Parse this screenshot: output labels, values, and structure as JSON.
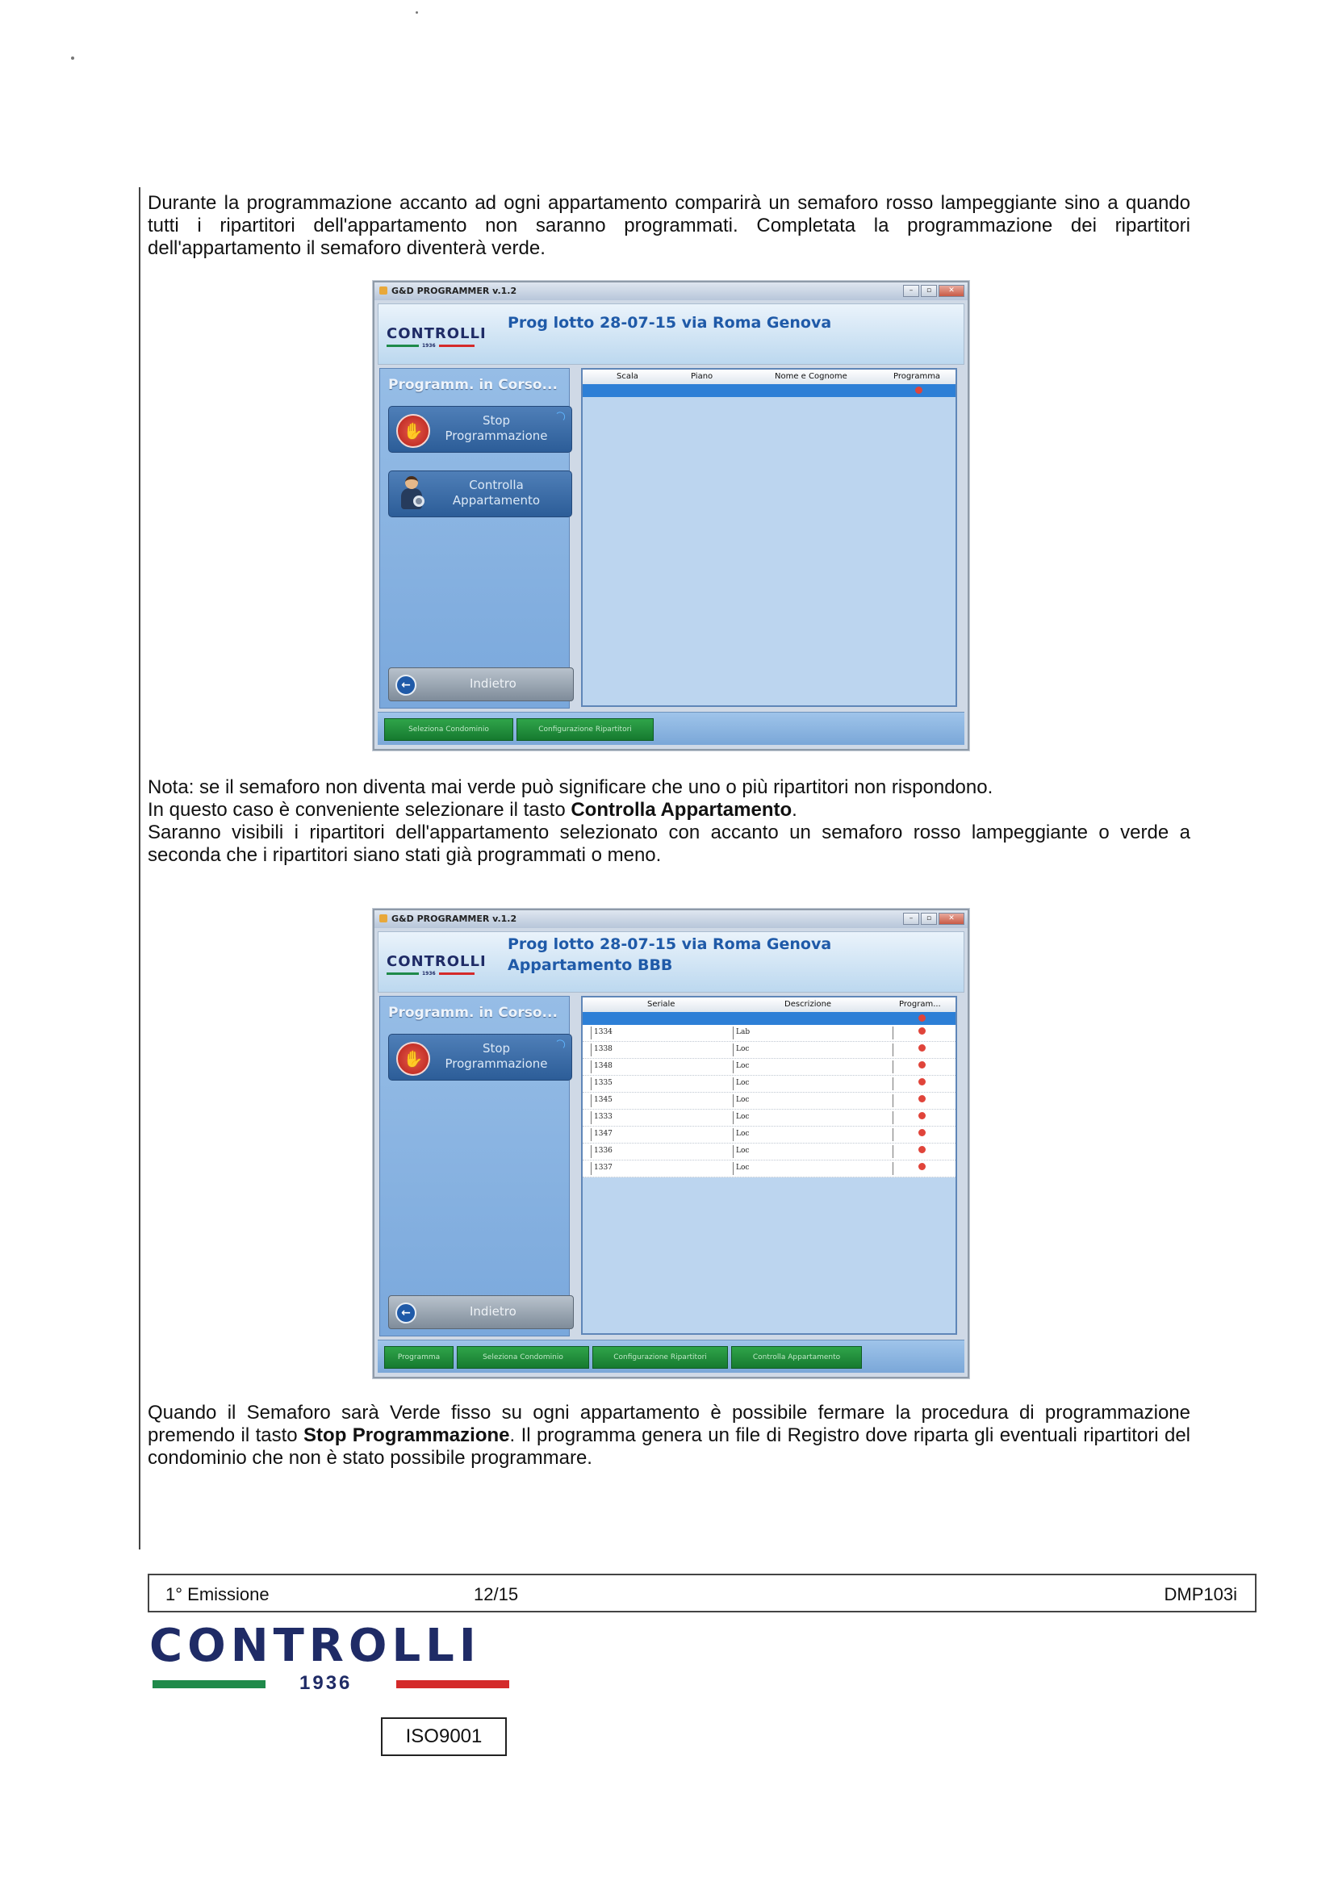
{
  "intro": {
    "text": "Durante la programmazione accanto ad ogni appartamento comparirà un semaforo rosso lampeggiante sino a quando tutti i ripartitori dell'appartamento non saranno programmati. Completata la programmazione dei ripartitori dell'appartamento il semaforo diventerà verde."
  },
  "screenshot1": {
    "window_title": "G&D PROGRAMMER v.1.2",
    "logo_word": "CONTROLLI",
    "logo_year": "1936",
    "header_title": "Prog lotto 28-07-15 via Roma Genova",
    "status": "Programm. in Corso...",
    "stop_button": {
      "line1": "Stop",
      "line2": "Programmazione"
    },
    "check_button": {
      "line1": "Controlla",
      "line2": "Appartamento"
    },
    "back_button": "Indietro",
    "columns": [
      "Scala",
      "Piano",
      "Nome e Cognome",
      "Programma"
    ],
    "tabs": [
      "Seleziona Condominio",
      "Configurazione Ripartitori"
    ],
    "colors": {
      "accent": "#1f5aa8",
      "panel": "#7aa8dc",
      "selection": "#2d7fd6",
      "tab": "#167a2f",
      "semaforo": "#e0443a"
    }
  },
  "notes": {
    "line1": "Nota: se il semaforo non diventa mai verde può significare che uno o più ripartitori non rispondono.",
    "line2_prefix": "In questo caso è conveniente selezionare il tasto ",
    "line2_bold": "Controlla Appartamento",
    "line2_suffix": ".",
    "line3": "Saranno visibili i ripartitori dell'appartamento selezionato con accanto un semaforo rosso lampeggiante o verde a seconda che i ripartitori siano stati già programmati o meno."
  },
  "screenshot2": {
    "window_title": "G&D PROGRAMMER v.1.2",
    "logo_word": "CONTROLLI",
    "logo_year": "1936",
    "header_title": "Prog lotto 28-07-15 via Roma Genova",
    "header_subtitle": "Appartamento BBB",
    "status": "Programm. in Corso...",
    "stop_button": {
      "line1": "Stop",
      "line2": "Programmazione"
    },
    "back_button": "Indietro",
    "columns": [
      "Seriale",
      "Descrizione",
      "Program..."
    ],
    "rows": [
      {
        "seriale": "1334",
        "descrizione": "Lab"
      },
      {
        "seriale": "1338",
        "descrizione": "Loc"
      },
      {
        "seriale": "1348",
        "descrizione": "Loc"
      },
      {
        "seriale": "1335",
        "descrizione": "Loc"
      },
      {
        "seriale": "1345",
        "descrizione": "Loc"
      },
      {
        "seriale": "1333",
        "descrizione": "Loc"
      },
      {
        "seriale": "1347",
        "descrizione": "Loc"
      },
      {
        "seriale": "1336",
        "descrizione": "Loc"
      },
      {
        "seriale": "1337",
        "descrizione": "Loc"
      }
    ],
    "tabs": [
      "Programma",
      "Seleziona Condominio",
      "Configurazione Ripartitori",
      "Controlla Appartamento"
    ]
  },
  "closing": {
    "prefix": "Quando il Semaforo sarà Verde fisso su ogni appartamento è possibile fermare la procedura di programmazione premendo il tasto ",
    "bold": "Stop Programmazione",
    "suffix": ". Il programma genera un file di Registro dove riparta gli eventuali ripartitori del condominio che non è stato possibile programmare."
  },
  "footer": {
    "edition": "1° Emissione",
    "page": "12/15",
    "code": "DMP103i",
    "brand_word": "CONTROLLI",
    "brand_year": "1936",
    "iso": "ISO9001"
  }
}
